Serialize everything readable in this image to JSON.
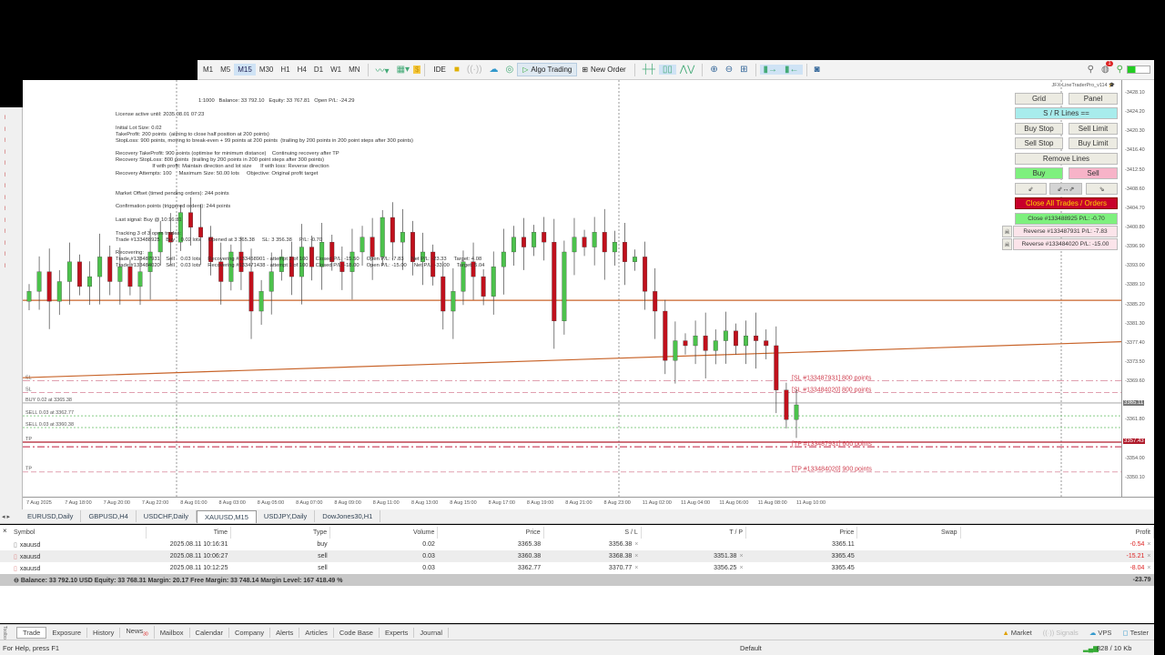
{
  "toolbar": {
    "timeframes": [
      "M1",
      "M5",
      "M15",
      "M30",
      "H1",
      "H4",
      "D1",
      "W1",
      "MN"
    ],
    "active_timeframe": "M15",
    "ide": "IDE",
    "algo_trading": "Algo Trading",
    "new_order": "New Order",
    "notifications_count": "1"
  },
  "info": {
    "lines": [
      "1:1000   Balance: 33 792.10   Equity: 33 767.81   Open P/L: -24.29",
      "License active until: 2035.08.01 07:23",
      "Initial Lot Size: 0.02",
      "TakeProfit: 200 points  (aiming to close half position at 200 points)",
      "StopLoss: 900 points, moving to break-even + 99 points at 200 points  (trailing by 200 points in 200 point steps after 300 points)",
      "Recovery TakeProfit: 900 points (optimise for minimum distance)    Continuing recovery after TP",
      "Recovery StopLoss: 800 points  (trailing by 200 points in 200 point steps after 300 points)",
      "                         If with profit: Maintain direction and lot size      If with loss: Reverse direction",
      "Recovery Attempts: 100     Maximum Size: 50.00 lots     Objective: Original profit target",
      "Market Offset (timed pending orders): 244 points",
      "Confirmation points (triggered orders): 244 points",
      "Last signal: Buy @ 10:16:31",
      "Tracking 3 of 3 open trades:",
      "Trade #133488925    Buy    0.02 lots     Opened at 3 365.38     SL: 3 356.38     P/L: -0.70",
      "Recovering:",
      "Trade #133487931    Sell    0.03 lots     Recovering #133458901 - attempt 2 of 100     Closed P/L: -15.50     Open P/L: -7.83     Net P/L: -23.33     Target: 4.08",
      "Trade #133484020    Sell    0.03 lots     Recovering #133471438 - attempt 1 of 100     Closed P/L: -18.00     Open P/L: -15.00     Net P/L: -33.00     Target: 5.04"
    ]
  },
  "panel": {
    "title": "JFX-LineTraderPro_v114",
    "grid": "Grid",
    "panel": "Panel",
    "sr_lines": "S / R Lines ==",
    "buy_stop": "Buy Stop",
    "sell_limit": "Sell Limit",
    "sell_stop": "Sell Stop",
    "buy_limit": "Buy Limit",
    "remove_lines": "Remove Lines",
    "buy": "Buy",
    "sell": "Sell",
    "close_all": "Close All Trades / Orders",
    "close_trade": "Close #133488925   P/L: -0.70",
    "reverse": [
      "Reverse #133487931   P/L: -7.83",
      "Reverse #133484020   P/L: -15.00"
    ]
  },
  "chart_data": {
    "type": "candlestick",
    "symbol": "XAUUSD,M15",
    "ylim": [
      3350.1,
      3428.1
    ],
    "price_ticks": [
      3428.1,
      3424.2,
      3420.3,
      3416.4,
      3412.5,
      3408.6,
      3404.7,
      3400.8,
      3396.9,
      3393.0,
      3389.1,
      3385.2,
      3381.3,
      3377.4,
      3373.5,
      3369.6,
      3361.8,
      3354.0,
      3350.1
    ],
    "time_ticks": [
      "7 Aug 2025",
      "7 Aug 18:00",
      "7 Aug 20:00",
      "7 Aug 22:00",
      "8 Aug 01:00",
      "8 Aug 03:00",
      "8 Aug 05:00",
      "8 Aug 07:00",
      "8 Aug 09:00",
      "8 Aug 11:00",
      "8 Aug 13:00",
      "8 Aug 15:00",
      "8 Aug 17:00",
      "8 Aug 19:00",
      "8 Aug 21:00",
      "8 Aug 23:00",
      "11 Aug 02:00",
      "11 Aug 04:00",
      "11 Aug 06:00",
      "11 Aug 08:00",
      "11 Aug 10:00"
    ],
    "closes": [
      3388,
      3392,
      3386,
      3390,
      3394,
      3389,
      3391,
      3395,
      3390,
      3393,
      3389,
      3392,
      3396,
      3400,
      3398,
      3404,
      3401,
      3399,
      3394,
      3390,
      3396,
      3392,
      3384,
      3388,
      3392,
      3395,
      3391,
      3397,
      3393,
      3398,
      3394,
      3392,
      3396,
      3399,
      3395,
      3403,
      3398,
      3400,
      3394,
      3396,
      3391,
      3384,
      3388,
      3394,
      3391,
      3387,
      3393,
      3396,
      3399,
      3397,
      3400,
      3398,
      3382,
      3396,
      3399,
      3397,
      3400,
      3396,
      3398,
      3394,
      3395,
      3388,
      3384,
      3374,
      3378,
      3377,
      3379,
      3376,
      3378,
      3380,
      3377,
      3379,
      3378,
      3377,
      3368,
      3362,
      3365
    ],
    "current_bid": "3365.11",
    "current_ask": "3357.43",
    "levels": [
      {
        "price": 3386.2,
        "style": "solid",
        "color": "#c8642a",
        "label": ""
      },
      {
        "price": 3369.9,
        "style": "dashdot",
        "color": "#e0a0b0",
        "label": "SL",
        "note": "[SL #133487931]   800 points"
      },
      {
        "price": 3367.5,
        "style": "dash",
        "color": "#e0a0b0",
        "label": "SL",
        "note": "[SL #133484020]   800 points"
      },
      {
        "price": 3365.38,
        "style": "solid",
        "color": "#b0b0b0",
        "label": "BUY 0.02 at 3365.38",
        "note": ""
      },
      {
        "price": 3362.77,
        "style": "dot",
        "color": "#8c8",
        "label": "SELL 0.03 at 3362.77",
        "note": ""
      },
      {
        "price": 3360.38,
        "style": "dot",
        "color": "#8c8",
        "label": "SELL 0.03 at 3360.38",
        "note": ""
      },
      {
        "price": 3357.43,
        "style": "solid",
        "color": "#b01c2c",
        "label": "TP",
        "note": ""
      },
      {
        "price": 3356.5,
        "style": "dashdot",
        "color": "#c01c3c",
        "label": "",
        "note": "[TP #133487931]   600 points"
      },
      {
        "price": 3351.4,
        "style": "dash",
        "color": "#e0a0b0",
        "label": "TP",
        "note": "[TP #133484020]   900 points"
      }
    ],
    "trendline": {
      "from": 3370.5,
      "to": 3377.8,
      "color": "#c8642a"
    }
  },
  "chart_tabs": [
    "EURUSD,Daily",
    "GBPUSD,H4",
    "USDCHF,Daily",
    "XAUUSD,M15",
    "USDJPY,Daily",
    "DowJones30,H1"
  ],
  "active_chart_tab": "XAUUSD,M15",
  "trade_table": {
    "columns": [
      "Symbol",
      "Time",
      "Type",
      "Volume",
      "Price",
      "S / L",
      "T / P",
      "Price",
      "Swap",
      "Profit"
    ],
    "rows": [
      {
        "symbol": "xauusd",
        "time": "2025.08.11 10:16:31",
        "type": "buy",
        "volume": "0.02",
        "price": "3365.38",
        "sl": "3356.38",
        "tp": "",
        "cur": "3365.11",
        "swap": "",
        "profit": "-0.54"
      },
      {
        "symbol": "xauusd",
        "time": "2025.08.11 10:06:27",
        "type": "sell",
        "volume": "0.03",
        "price": "3360.38",
        "sl": "3368.38",
        "tp": "3351.38",
        "cur": "3365.45",
        "swap": "",
        "profit": "-15.21"
      },
      {
        "symbol": "xauusd",
        "time": "2025.08.11 10:12:25",
        "type": "sell",
        "volume": "0.03",
        "price": "3362.77",
        "sl": "3370.77",
        "tp": "3356.25",
        "cur": "3365.45",
        "swap": "",
        "profit": "-8.04"
      }
    ],
    "balance_line": "Balance: 33 792.10 USD  Equity: 33 768.31  Margin: 20.17  Free Margin: 33 748.14  Margin Level: 167 418.49 %",
    "total_profit": "-23.79"
  },
  "bottom_tabs": [
    "Trade",
    "Exposure",
    "History",
    "News",
    "Mailbox",
    "Calendar",
    "Company",
    "Alerts",
    "Articles",
    "Code Base",
    "Experts",
    "Journal"
  ],
  "news_badge": "30",
  "right_tabs": [
    "Market",
    "Signals",
    "VPS",
    "Tester"
  ],
  "status": {
    "help": "For Help, press F1",
    "profile": "Default",
    "traffic": "828 / 10 Kb"
  },
  "colors": {
    "bull": "#4cc24c",
    "bear": "#c0101c",
    "accent": "#c8002a"
  }
}
